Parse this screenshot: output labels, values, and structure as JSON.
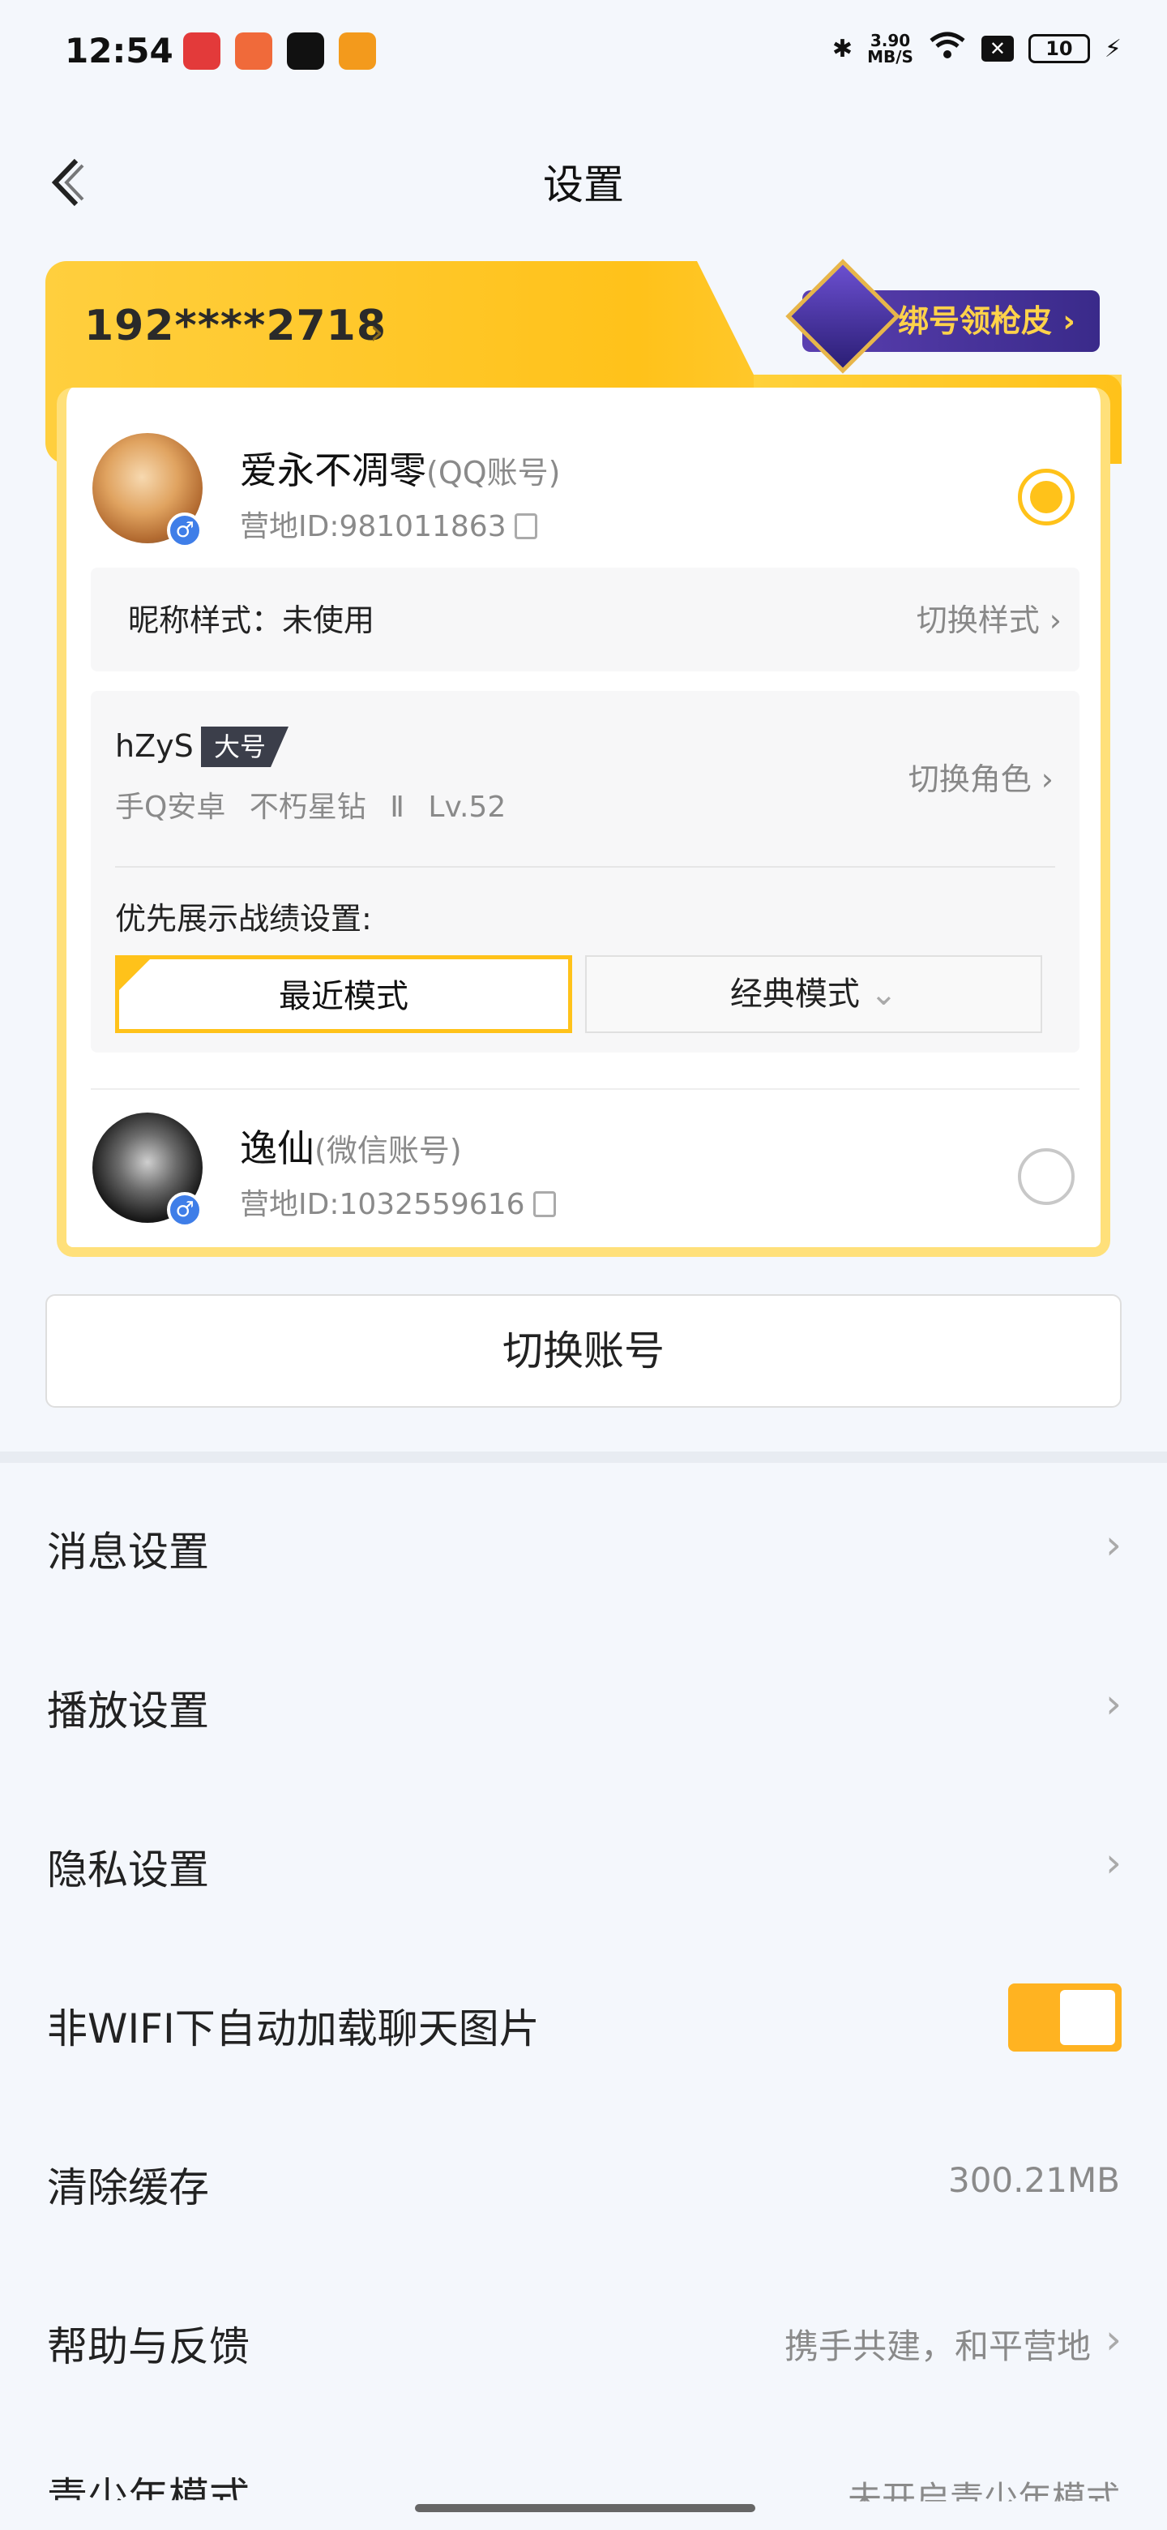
{
  "status_bar": {
    "time": "12:54",
    "net_speed_value": "3.90",
    "net_speed_unit": "MB/S",
    "battery": "10"
  },
  "header": {
    "title": "设置"
  },
  "account_card": {
    "phone_masked": "192****2718",
    "bind_promo": "绑号领枪皮",
    "accounts": [
      {
        "name": "爱永不凋零",
        "type": "(QQ账号)",
        "camp_id": "营地ID:981011863",
        "selected": true
      },
      {
        "name": "逸仙",
        "type": "(微信账号)",
        "camp_id": "营地ID:1032559616",
        "selected": false
      }
    ],
    "nickname_style_label": "昵称样式：未使用",
    "nickname_style_switch": "切换样式",
    "role": {
      "name": "hZyS",
      "tag": "大号",
      "platform": "手Q安卓",
      "rank": "不朽星钻 Ⅱ",
      "level": "Lv.52",
      "switch_label": "切换角色"
    },
    "record_pref_label": "优先展示战绩设置:",
    "modes": {
      "recent": "最近模式",
      "classic": "经典模式"
    }
  },
  "switch_account_label": "切换账号",
  "settings": {
    "message": "消息设置",
    "playback": "播放设置",
    "privacy": "隐私设置",
    "auto_load_images": "非WIFI下自动加载聊天图片",
    "auto_load_images_on": true,
    "clear_cache": "清除缓存",
    "cache_size": "300.21MB",
    "help": "帮助与反馈",
    "help_value": "携手共建，和平营地",
    "youth_mode": "青少年模式",
    "youth_mode_value": "未开启青少年模式"
  },
  "colors": {
    "accent": "#ffc21a",
    "toggle_on": "#ffb321",
    "badge_purple": "#4a34a0"
  }
}
